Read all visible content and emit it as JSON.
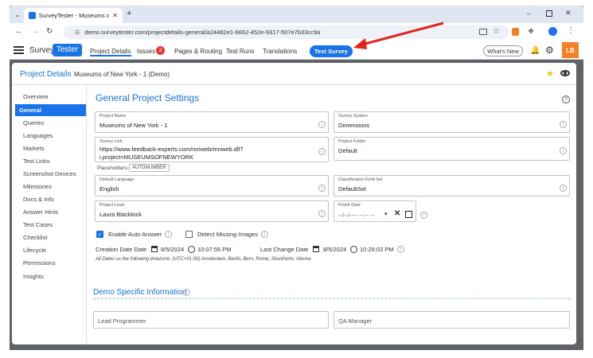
{
  "browser": {
    "tab_title": "SurveyTester - Museums of Ne...",
    "url": "demo.surveytester.com/projectdetails-general/a24482e1-6662-452e-9317-507e7b33cc9a"
  },
  "app": {
    "brand_survey": "Survey",
    "brand_tester": "Tester",
    "nav": {
      "project_details": "Project Details",
      "issues": "Issues",
      "issues_count": "3",
      "pages_routing": "Pages & Routing",
      "test_runs": "Test Runs",
      "translations": "Translations"
    },
    "test_survey": "Test Survey",
    "whats_new": "What's New",
    "avatar": "LB",
    "accent": "#1a73e8",
    "avatar_color": "#f58025"
  },
  "panel": {
    "title": "Project Details",
    "subtitle": "Museums of New York - 1 (Demo)"
  },
  "sidebar": [
    {
      "label": "Overview"
    },
    {
      "label": "General"
    },
    {
      "label": "Queries"
    },
    {
      "label": "Languages"
    },
    {
      "label": "Markets"
    },
    {
      "label": "Test Links"
    },
    {
      "label": "Screenshot Devices"
    },
    {
      "label": "Milestones"
    },
    {
      "label": "Docs & Info"
    },
    {
      "label": "Answer Hints"
    },
    {
      "label": "Test Cases"
    },
    {
      "label": "Checklist"
    },
    {
      "label": "Lifecycle"
    },
    {
      "label": "Permissions"
    },
    {
      "label": "Insights"
    }
  ],
  "general": {
    "section_title": "General Project Settings",
    "project_name": {
      "label": "Project Name",
      "value": "Museums of New York - 1"
    },
    "survey_system": {
      "label": "Survey System",
      "value": "Dimensions"
    },
    "survey_link": {
      "label": "Survey Link",
      "line1": "https://www.feedback-experts.com/mriweb/mriweb.dll?",
      "line2": "i.project=MUSEUMSOFNEWYORK"
    },
    "placeholders_label": "Placeholders:",
    "placeholder_tag": "AUTONUMBER",
    "project_folder": {
      "label": "Project Folder",
      "value": "Default"
    },
    "default_language": {
      "label": "Default Language",
      "value": "English"
    },
    "classification_field_set": {
      "label": "Classification Field Set",
      "value": "DefaultSet"
    },
    "project_lead": {
      "label": "Project Lead",
      "value": "Laura Blacklock"
    },
    "finish_date": {
      "label": "Finish Date",
      "value": "--/--/---- --:-- --"
    },
    "enable_auto_answer": "Enable Auto Answer",
    "detect_missing_images": "Detect Missing Images",
    "creation_date_label": "Creation Date Date",
    "creation_date": "8/5/2024",
    "creation_time": "10:07:55 PM",
    "last_change_label": "Last Change Date",
    "last_change_date": "8/5/2024",
    "last_change_time": "10:26:03 PM",
    "timezone_note": "All Dates us the following timezone: (UTC+01:00) Amsterdam, Berlin, Bern, Rome, Stockholm, Vienna"
  },
  "demo": {
    "title": "Demo Specific Information",
    "lead_programmer": "Lead Programmer",
    "qa_manager": "QA Manager"
  }
}
